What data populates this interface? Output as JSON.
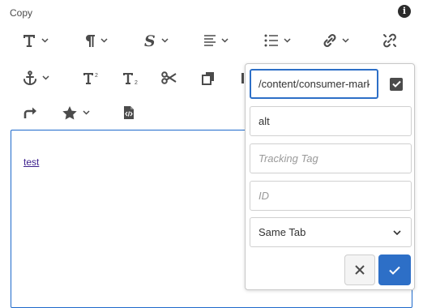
{
  "field_label": "Copy",
  "info_glyph": "i",
  "editor": {
    "link_text": "test"
  },
  "toolbar": {
    "row1": [
      {
        "name": "format-icon",
        "dropdown": true
      },
      {
        "name": "paragraph-icon",
        "dropdown": true
      },
      {
        "name": "styles-icon",
        "dropdown": true
      },
      {
        "name": "justify-icon",
        "dropdown": true
      },
      {
        "name": "list-icon",
        "dropdown": true
      },
      {
        "name": "link-icon",
        "dropdown": true
      },
      {
        "name": "unlink-icon",
        "dropdown": false
      }
    ],
    "row2": [
      {
        "name": "anchor-icon",
        "dropdown": true
      },
      {
        "name": "superscript-icon",
        "dropdown": false
      },
      {
        "name": "subscript-icon",
        "dropdown": false
      },
      {
        "name": "cut-icon",
        "dropdown": false
      },
      {
        "name": "paste-icon",
        "dropdown": false
      }
    ],
    "row3": [
      {
        "name": "redo-icon",
        "dropdown": false
      },
      {
        "name": "star-icon",
        "dropdown": true
      },
      {
        "name": "source-edit-icon",
        "dropdown": false
      }
    ]
  },
  "link_dialog": {
    "path_value": "/content/consumer-marke",
    "alt_value": "alt",
    "tracking_placeholder": "Tracking Tag",
    "id_placeholder": "ID",
    "target_selected": "Same Tab"
  },
  "colors": {
    "accent": "#2d6fc7",
    "icon": "#4b4b4b",
    "link": "#3b1e8c"
  }
}
